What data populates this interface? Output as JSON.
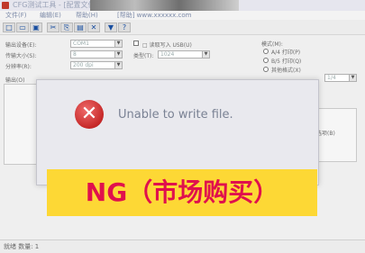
{
  "window": {
    "title": "CFG测试工具 - [配置文件编辑器]"
  },
  "menu": {
    "items": [
      "文件(F)",
      "编辑(E)",
      "帮助(H)"
    ],
    "url_text": "[帮助] www.xxxxxx.com"
  },
  "form": {
    "label_1": "输出设备(E):",
    "value_1": "COM1",
    "label_2": "传输大小(S):",
    "value_2": "8",
    "label_3": "分辨率(R):",
    "value_3": "200 dpi",
    "checkbox_label": "□ 读取写入 USB(U)",
    "label_4": "类型(T):",
    "value_4": "1024",
    "right_label": "模式(M):",
    "radio_1": "A/4 打印(P)",
    "radio_2": "B/5 打印(Q)",
    "radio_3": "其他格式(X)",
    "right_combo": "1/4",
    "section_label": "输出(O)",
    "side_button": "选项(B)"
  },
  "dialog": {
    "message": "Unable to write file.",
    "icon": "error-icon"
  },
  "banner": {
    "text": "NG（市场购买）",
    "bg": "#fdd835",
    "fg": "#e0104d"
  },
  "status": {
    "text": "就绪 数量: 1"
  }
}
